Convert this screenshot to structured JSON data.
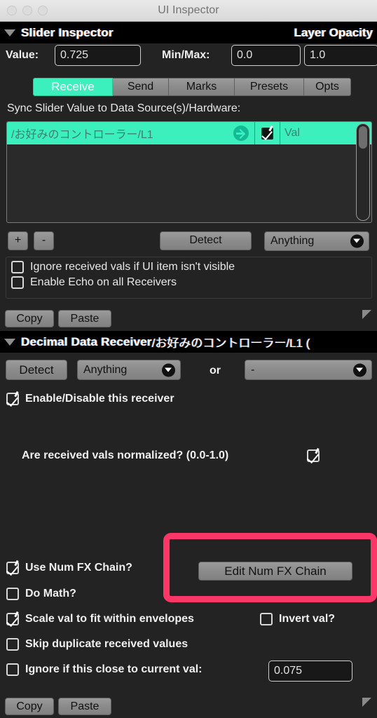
{
  "window": {
    "title": "UI Inspector",
    "traffic_lights": [
      "close-button",
      "minimize-button",
      "zoom-button"
    ]
  },
  "slider_inspector": {
    "header_title": "Slider Inspector",
    "header_right": "Layer Opacity",
    "value_label": "Value:",
    "value": "0.725",
    "minmax_label": "Min/Max:",
    "min": "0.0",
    "max": "1.0",
    "tabs": [
      {
        "label": "Receive",
        "active": true
      },
      {
        "label": "Send",
        "active": false
      },
      {
        "label": "Marks",
        "active": false
      },
      {
        "label": "Presets",
        "active": false
      },
      {
        "label": "Opts",
        "active": false
      }
    ],
    "sync_label": "Sync Slider Value to Data Source(s)/Hardware:",
    "list_rows": [
      {
        "path": "/お好みのコントローラー/L1",
        "enabled": true,
        "value_mode": "Val"
      }
    ],
    "add_button": "+",
    "remove_button": "-",
    "detect_button": "Detect",
    "filter_dropdown": "Anything",
    "options": [
      {
        "label": "Ignore received vals if UI item isn't visible",
        "checked": false
      },
      {
        "label": "Enable Echo on all Receivers",
        "checked": false
      }
    ],
    "copy_button": "Copy",
    "paste_button": "Paste"
  },
  "decimal_receiver": {
    "header_title": "Decimal Data Receiver",
    "header_path": "/お好みのコントローラー/L1 (",
    "detect_button": "Detect",
    "type_dropdown": "Anything",
    "or_label": "or",
    "second_dropdown": "-",
    "enable_option": {
      "label": "Enable/Disable this receiver",
      "checked": true
    },
    "normalized_option": {
      "label": "Are received vals normalized? (0.0-1.0)",
      "checked": true
    },
    "use_num_fx": {
      "label": "Use Num FX Chain?",
      "checked": true
    },
    "edit_fx_button": "Edit Num FX Chain",
    "do_math": {
      "label": "Do Math?",
      "checked": false
    },
    "scale_val": {
      "label": "Scale val to fit within envelopes",
      "checked": true
    },
    "invert_val": {
      "label": "Invert val?",
      "checked": false
    },
    "skip_dupes": {
      "label": "Skip duplicate received values",
      "checked": false
    },
    "ignore_close": {
      "label": "Ignore if this close to current val:",
      "checked": false
    },
    "ignore_close_value": "0.075",
    "copy_button": "Copy",
    "paste_button": "Paste"
  },
  "annotation": {
    "color": "#fc3667",
    "target": "edit-num-fx-chain-button"
  }
}
